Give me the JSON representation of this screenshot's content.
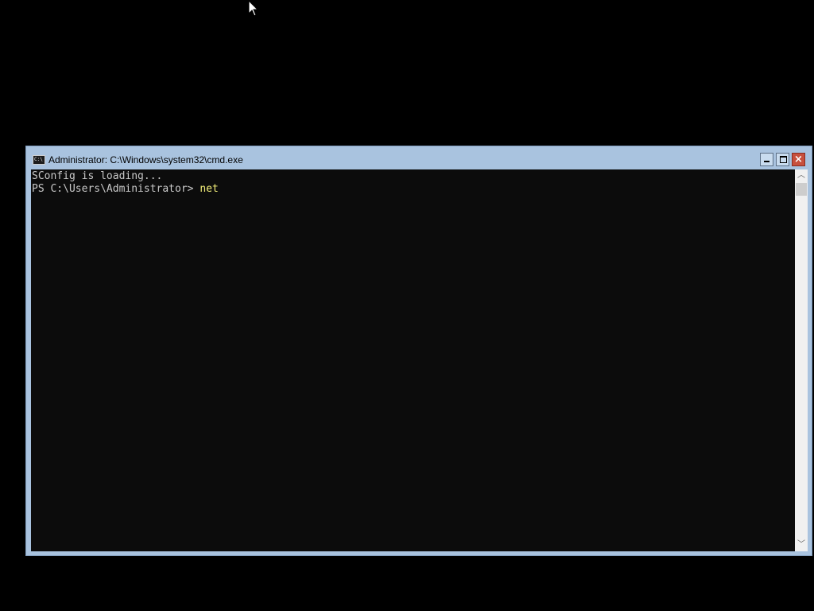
{
  "window": {
    "title": "Administrator: C:\\Windows\\system32\\cmd.exe",
    "icon": "C:\\",
    "controls": {
      "minimize": "minimize-icon",
      "maximize": "maximize-icon",
      "close": "×"
    }
  },
  "console": {
    "lines": [
      "SConfig is loading...",
      "PS C:\\Users\\Administrator> "
    ],
    "typed_command": "net"
  },
  "scrollbar": {
    "up_arrow": "︿",
    "down_arrow": "﹀"
  },
  "colors": {
    "console_bg": "#0c0c0c",
    "console_text": "#c8c8c8",
    "command_text": "#f5f07a",
    "title_bar": "#a9c3df",
    "close_button": "#c7503d"
  }
}
